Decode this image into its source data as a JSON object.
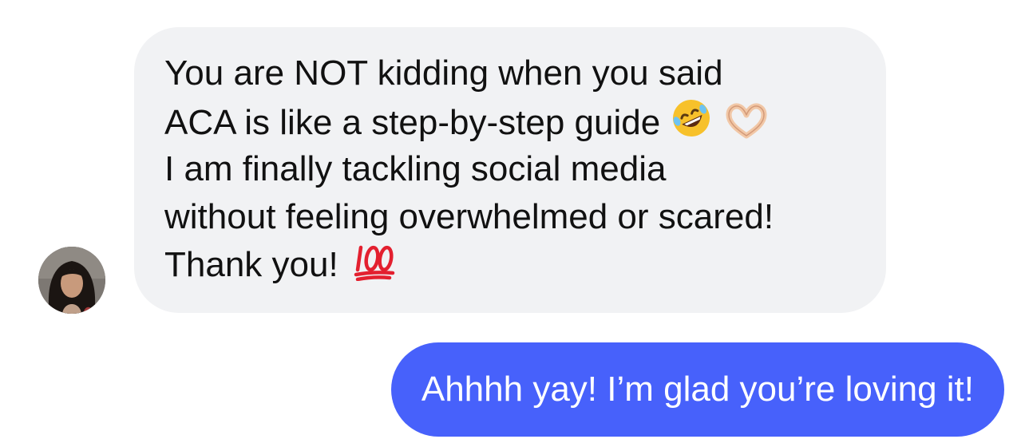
{
  "conversation": {
    "incoming": {
      "lines": [
        "You are NOT kidding when you said",
        "ACA is like a step-by-step guide",
        "I am finally tackling social media",
        "without feeling overwhelmed or scared!",
        "Thank you!"
      ],
      "line2_emojis": [
        "rofl-emoji",
        "heart-hands-emoji"
      ],
      "line5_emoji": "hundred-points-emoji",
      "bubble_color": "#f1f2f4",
      "text_color": "#111111"
    },
    "outgoing": {
      "text": "Ahhhh yay! I’m glad you’re loving it!",
      "bubble_color": "#4761fb",
      "text_color": "#ffffff"
    },
    "avatar_icon": "user-avatar"
  }
}
